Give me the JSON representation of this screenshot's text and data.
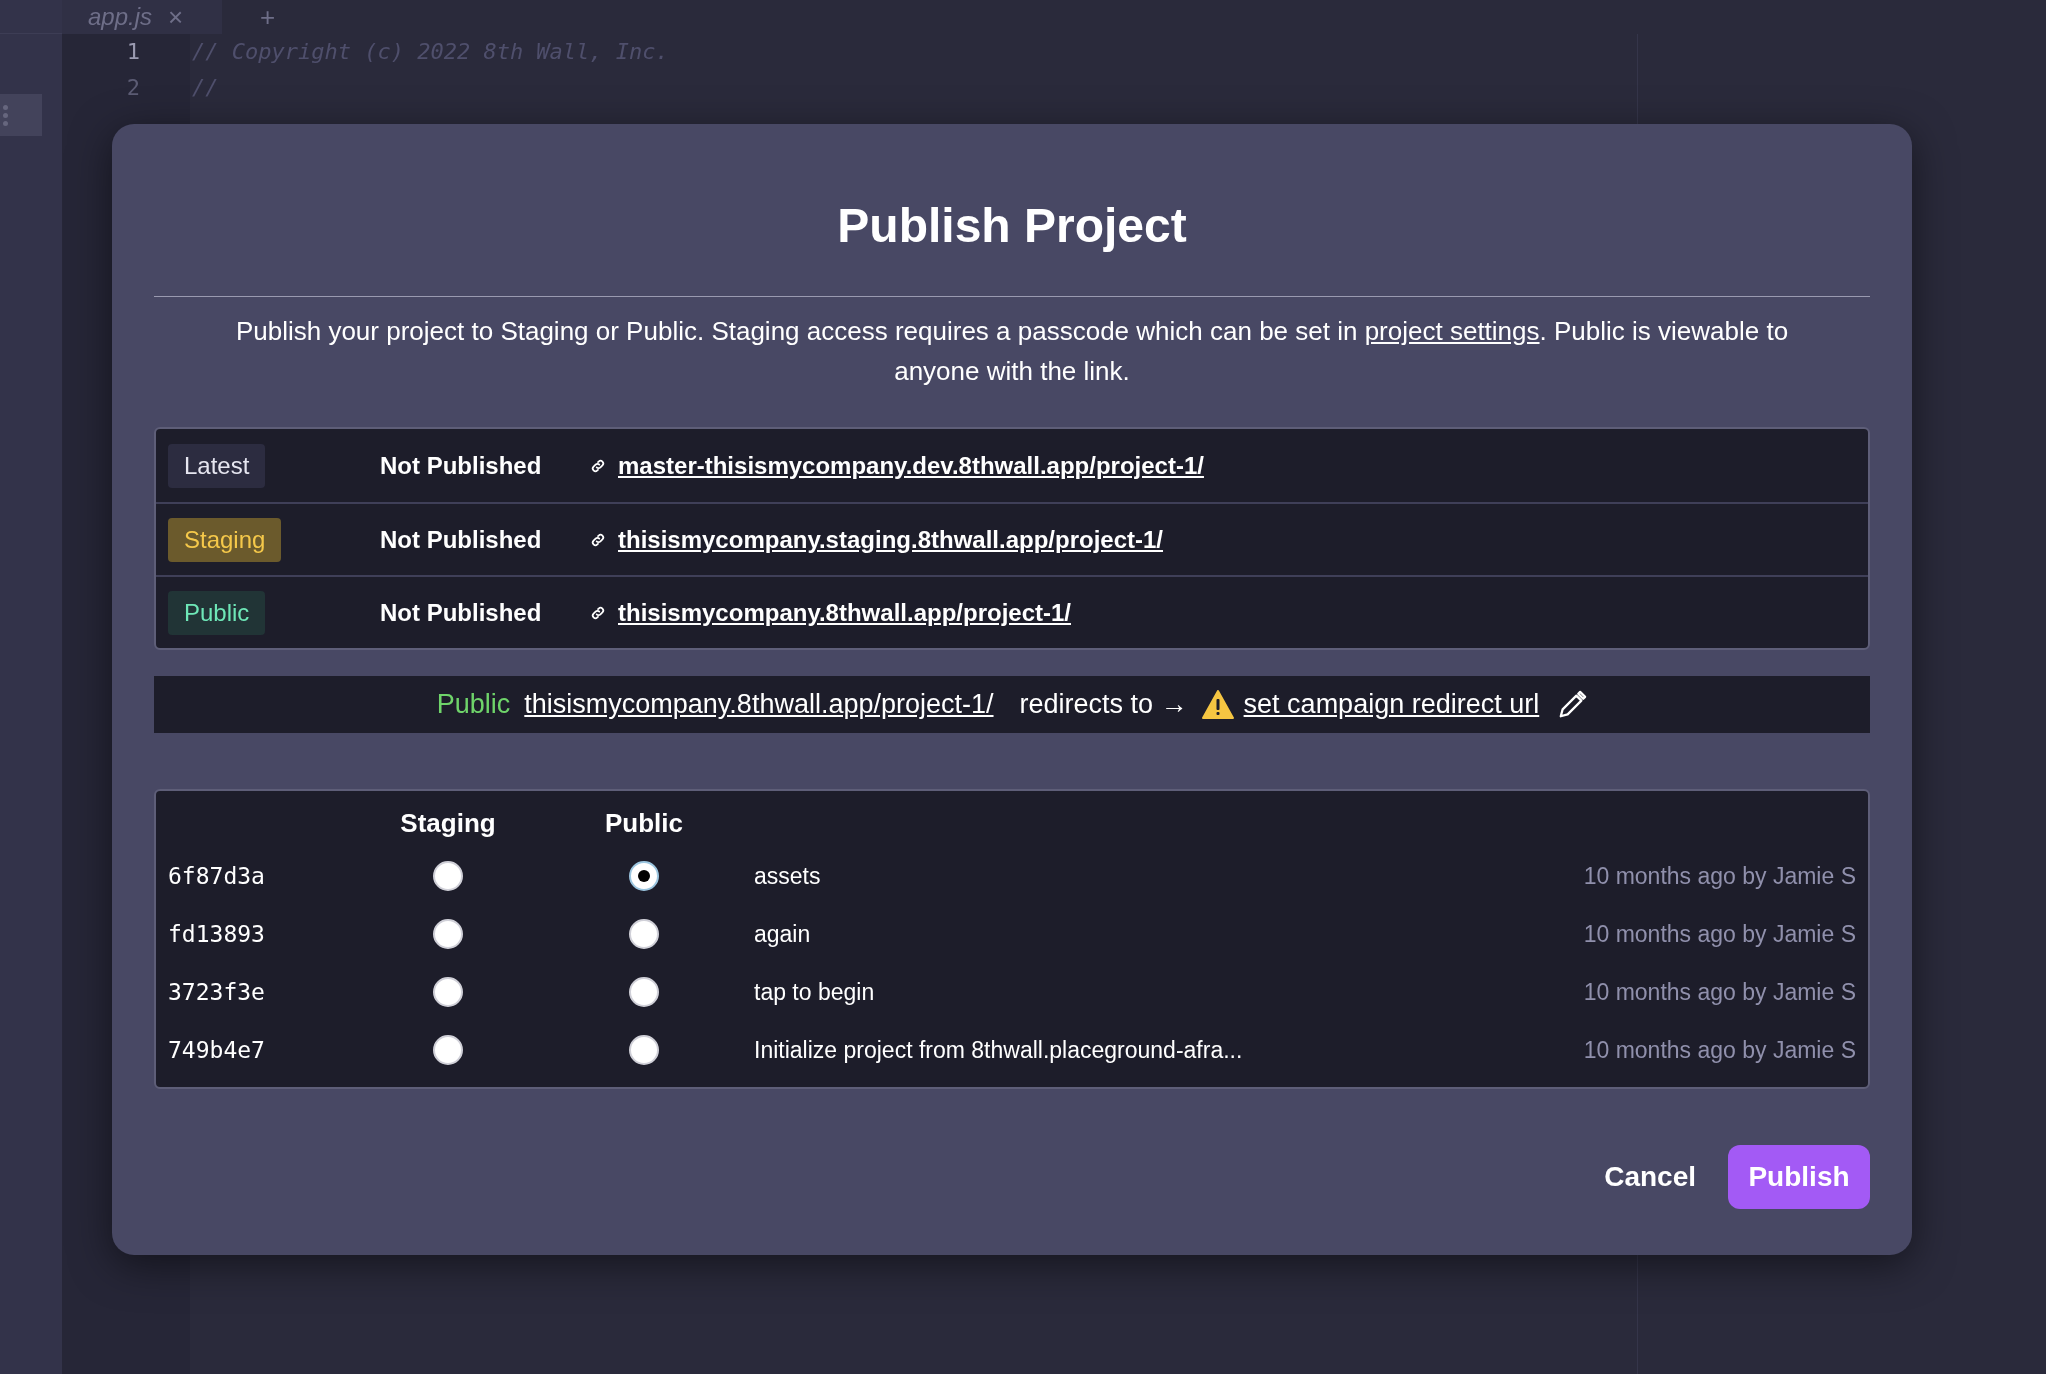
{
  "editor": {
    "tab": {
      "label": "app.js",
      "close": "×",
      "add": "+"
    },
    "lines": [
      {
        "number": "1",
        "text": "// Copyright (c) 2022 8th Wall, Inc."
      },
      {
        "number": "2",
        "text": "//"
      }
    ]
  },
  "dialog": {
    "title": "Publish Project",
    "description_before": "Publish your project to Staging or Public. Staging access requires a passcode which can be set in ",
    "description_link": "project settings",
    "description_after": ". Public is viewable to anyone with the link.",
    "environments": [
      {
        "label": "Latest",
        "kind": "latest",
        "status": "Not Published",
        "url": "master-thisismycompany.dev.8thwall.app/project-1/"
      },
      {
        "label": "Staging",
        "kind": "staging",
        "status": "Not Published",
        "url": "thisismycompany.staging.8thwall.app/project-1/"
      },
      {
        "label": "Public",
        "kind": "public",
        "status": "Not Published",
        "url": "thisismycompany.8thwall.app/project-1/"
      }
    ],
    "redirect": {
      "label": "Public",
      "url": "thisismycompany.8thwall.app/project-1/",
      "text": "redirects to →",
      "link": "set campaign redirect url"
    },
    "commits": {
      "columns": [
        "Staging",
        "Public"
      ],
      "rows": [
        {
          "hash": "6f87d3a",
          "staging_selected": false,
          "public_selected": true,
          "message": "assets",
          "meta": "10 months ago by Jamie S"
        },
        {
          "hash": "fd13893",
          "staging_selected": false,
          "public_selected": false,
          "message": "again",
          "meta": "10 months ago by Jamie S"
        },
        {
          "hash": "3723f3e",
          "staging_selected": false,
          "public_selected": false,
          "message": "tap to begin",
          "meta": "10 months ago by Jamie S"
        },
        {
          "hash": "749b4e7",
          "staging_selected": false,
          "public_selected": false,
          "message": "Initialize project from 8thwall.placeground-afra...",
          "meta": "10 months ago by Jamie S"
        }
      ]
    },
    "buttons": {
      "cancel": "Cancel",
      "publish": "Publish"
    }
  }
}
